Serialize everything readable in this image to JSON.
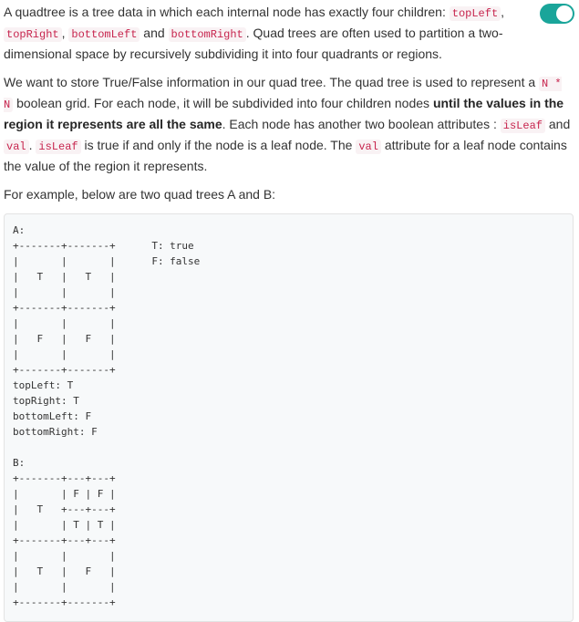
{
  "toggle": {
    "state": "on"
  },
  "intro": {
    "t1": "A quadtree is a tree data in which each internal node has exactly four children: ",
    "c1": "topLeft",
    "t2": ", ",
    "c2": "topRight",
    "t3": ", ",
    "c3": "bottomLeft",
    "t4": " and ",
    "c4": "bottomRight",
    "t5": ". Quad trees are often used to partition a two-dimensional space by recursively subdividing it into four quadrants or regions."
  },
  "para2": {
    "t1": "We want to store True/False information in our quad tree. The quad tree is used to represent a ",
    "c1": "N * N",
    "t2": " boolean grid. For each node, it will be subdivided into four children nodes ",
    "b1": "until the values in the region it represents are all the same",
    "t3": ". Each node has another two boolean attributes : ",
    "c2": "isLeaf",
    "t4": " and ",
    "c3": "val",
    "t5": ". ",
    "c4": "isLeaf",
    "t6": " is true if and only if the node is a leaf node. The ",
    "c5": "val",
    "t7": " attribute for a leaf node contains the value of the region it represents."
  },
  "para3": {
    "text": "For example, below are two quad trees A and B:"
  },
  "example": {
    "code": "A:\n+-------+-------+      T: true\n|       |       |      F: false\n|   T   |   T   |\n|       |       |\n+-------+-------+\n|       |       |\n|   F   |   F   |\n|       |       |\n+-------+-------+\ntopLeft: T\ntopRight: T\nbottomLeft: F\nbottomRight: F\n\nB:\n+-------+---+---+\n|       | F | F |\n|   T   +---+---+\n|       | T | T |\n+-------+---+---+\n|       |       |\n|   T   |   F   |\n|       |       |\n+-------+-------+"
  }
}
